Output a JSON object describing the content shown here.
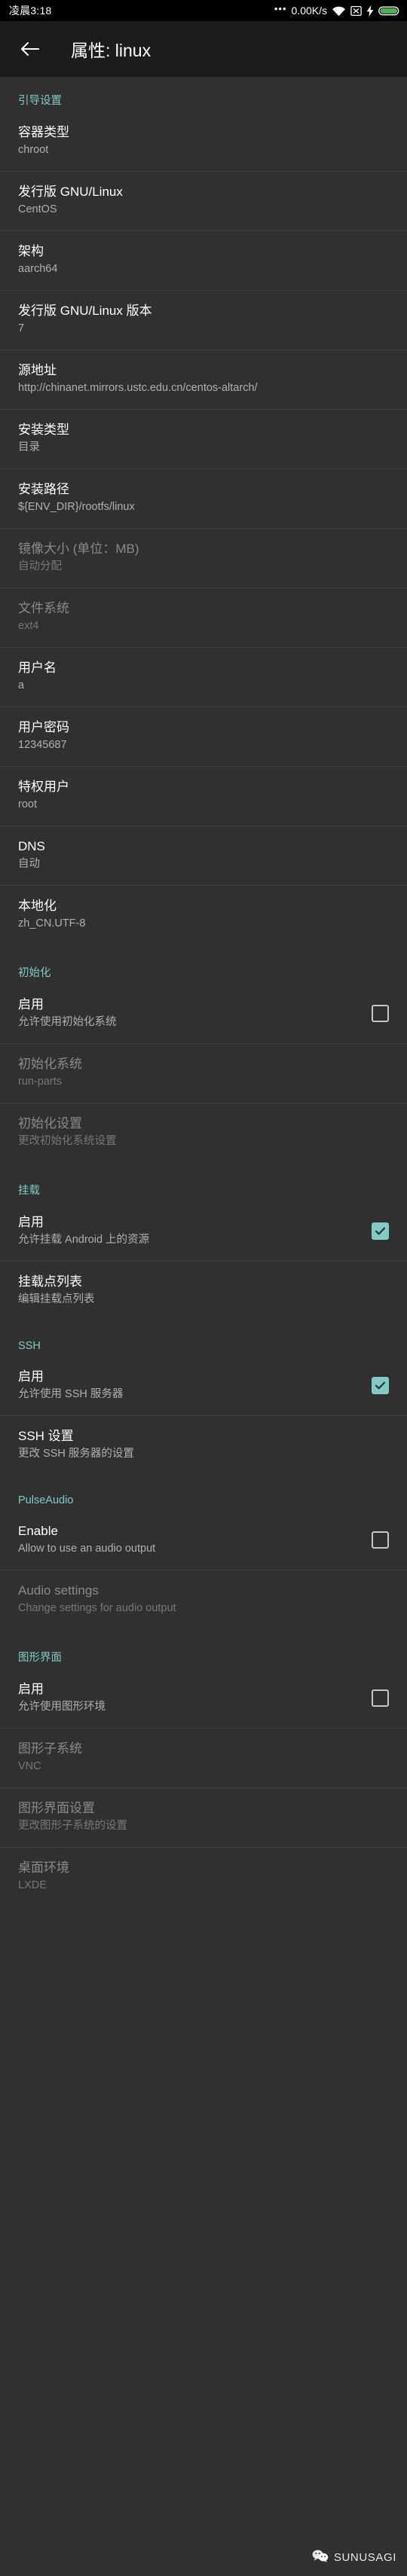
{
  "status_bar": {
    "clock": "凌晨3:18",
    "dots": "•••",
    "network_speed": "0.00K/s",
    "icons": [
      "wifi-icon",
      "no-sim-icon",
      "charging-bolt-icon",
      "battery-icon"
    ]
  },
  "app_bar": {
    "back_label": "←",
    "title": "属性: linux"
  },
  "colors": {
    "accent": "#80cbc4",
    "background": "#303030",
    "appbar_background": "#1c1c1c",
    "statusbar_background": "#000000",
    "divider": "#3d3d3d",
    "title_text": "#ffffff",
    "summary_text": "#b0b0b0",
    "disabled_title_text": "#8a8a8a",
    "disabled_summary_text": "#777777",
    "battery": "#4caf50"
  },
  "watermark": {
    "label": "SUNUSAGI",
    "icon": "wechat-icon"
  },
  "sections": [
    {
      "id": "boot",
      "header": "引导设置",
      "items": [
        {
          "id": "container-type",
          "title": "容器类型",
          "summary": "chroot",
          "type": "value",
          "disabled": false
        },
        {
          "id": "distribution",
          "title": "发行版 GNU/Linux",
          "summary": "CentOS",
          "type": "value",
          "disabled": false
        },
        {
          "id": "architecture",
          "title": "架构",
          "summary": "aarch64",
          "type": "value",
          "disabled": false
        },
        {
          "id": "distribution-ver",
          "title": "发行版 GNU/Linux 版本",
          "summary": "7",
          "type": "value",
          "disabled": false
        },
        {
          "id": "source-url",
          "title": "源地址",
          "summary": "http://chinanet.mirrors.ustc.edu.cn/centos-altarch/",
          "type": "value",
          "disabled": false
        },
        {
          "id": "install-type",
          "title": "安装类型",
          "summary": "目录",
          "type": "value",
          "disabled": false
        },
        {
          "id": "install-path",
          "title": "安装路径",
          "summary": "${ENV_DIR}/rootfs/linux",
          "type": "value",
          "disabled": false
        },
        {
          "id": "image-size",
          "title": "镜像大小 (单位：MB)",
          "summary": "自动分配",
          "type": "value",
          "disabled": true
        },
        {
          "id": "filesystem",
          "title": "文件系统",
          "summary": "ext4",
          "type": "value",
          "disabled": true
        },
        {
          "id": "username",
          "title": "用户名",
          "summary": "a",
          "type": "value",
          "disabled": false
        },
        {
          "id": "user-password",
          "title": "用户密码",
          "summary": "12345687",
          "type": "value",
          "disabled": false
        },
        {
          "id": "privileged-user",
          "title": "特权用户",
          "summary": "root",
          "type": "value",
          "disabled": false
        },
        {
          "id": "dns",
          "title": "DNS",
          "summary": "自动",
          "type": "value",
          "disabled": false
        },
        {
          "id": "locale",
          "title": "本地化",
          "summary": "zh_CN.UTF-8",
          "type": "value",
          "disabled": false
        }
      ]
    },
    {
      "id": "init",
      "header": "初始化",
      "items": [
        {
          "id": "init-enable",
          "title": "启用",
          "summary": "允许使用初始化系统",
          "type": "checkbox",
          "checked": false,
          "disabled": false
        },
        {
          "id": "init-system",
          "title": "初始化系统",
          "summary": "run-parts",
          "type": "value",
          "disabled": true
        },
        {
          "id": "init-settings",
          "title": "初始化设置",
          "summary": "更改初始化系统设置",
          "type": "value",
          "disabled": true
        }
      ]
    },
    {
      "id": "mount",
      "header": "挂载",
      "items": [
        {
          "id": "mount-enable",
          "title": "启用",
          "summary": "允许挂载 Android 上的资源",
          "type": "checkbox",
          "checked": true,
          "disabled": false
        },
        {
          "id": "mount-point-list",
          "title": "挂载点列表",
          "summary": "编辑挂载点列表",
          "type": "value",
          "disabled": false
        }
      ]
    },
    {
      "id": "ssh",
      "header": "SSH",
      "items": [
        {
          "id": "ssh-enable",
          "title": "启用",
          "summary": "允许使用 SSH 服务器",
          "type": "checkbox",
          "checked": true,
          "disabled": false
        },
        {
          "id": "ssh-settings",
          "title": "SSH 设置",
          "summary": "更改 SSH 服务器的设置",
          "type": "value",
          "disabled": false
        }
      ]
    },
    {
      "id": "pulseaudio",
      "header": "PulseAudio",
      "items": [
        {
          "id": "audio-enable",
          "title": "Enable",
          "summary": "Allow to use an audio output",
          "type": "checkbox",
          "checked": false,
          "disabled": false
        },
        {
          "id": "audio-settings",
          "title": "Audio settings",
          "summary": "Change settings for audio output",
          "type": "value",
          "disabled": true
        }
      ]
    },
    {
      "id": "gui",
      "header": "图形界面",
      "items": [
        {
          "id": "gui-enable",
          "title": "启用",
          "summary": "允许使用图形环境",
          "type": "checkbox",
          "checked": false,
          "disabled": false
        },
        {
          "id": "gui-subsystem",
          "title": "图形子系统",
          "summary": "VNC",
          "type": "value",
          "disabled": true
        },
        {
          "id": "gui-settings",
          "title": "图形界面设置",
          "summary": "更改图形子系统的设置",
          "type": "value",
          "disabled": true
        },
        {
          "id": "desktop-env",
          "title": "桌面环境",
          "summary": "LXDE",
          "type": "value",
          "disabled": true
        }
      ]
    }
  ]
}
